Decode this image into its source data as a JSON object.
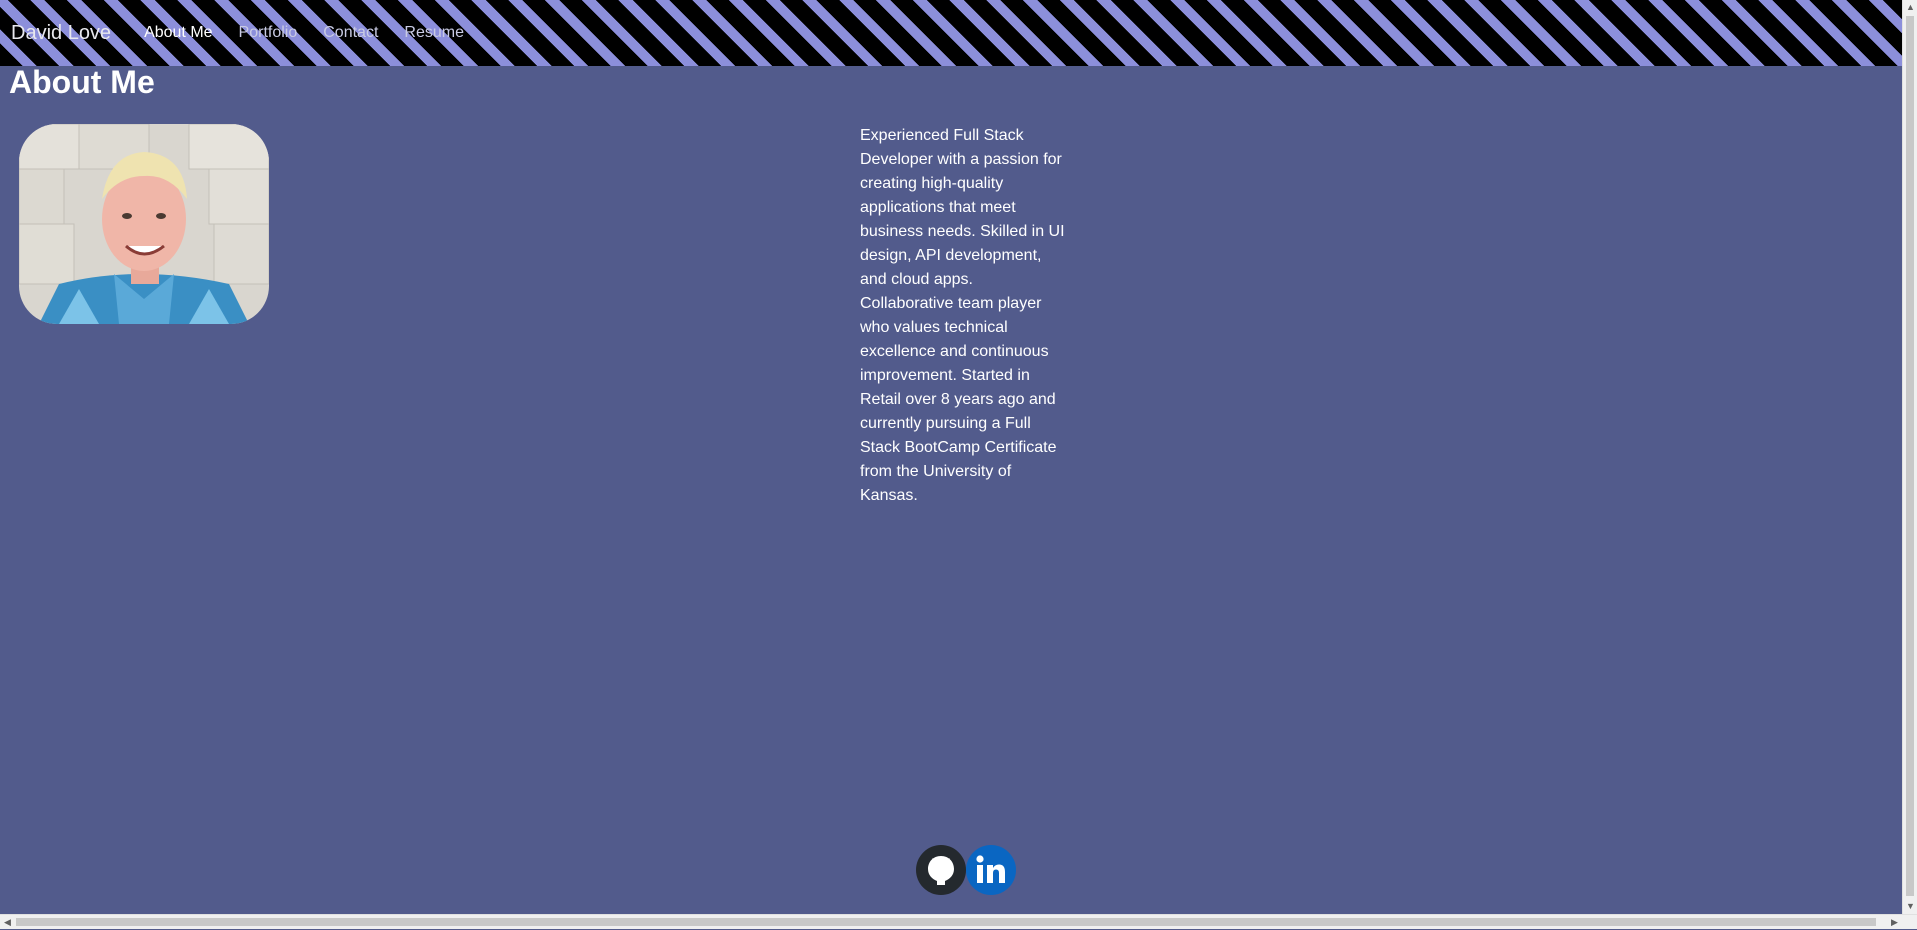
{
  "navbar": {
    "brand": "David Love",
    "links": [
      {
        "label": "About Me",
        "active": true
      },
      {
        "label": "Portfolio",
        "active": false
      },
      {
        "label": "Contact",
        "active": false
      },
      {
        "label": "Resume",
        "active": false
      }
    ],
    "stripe_colors": [
      "#000000",
      "#8c8fdb"
    ]
  },
  "main": {
    "title": "About Me",
    "bio": "Experienced Full Stack Developer with a passion for creating high-quality applications that meet business needs. Skilled in UI design, API development, and cloud apps. Collaborative team player who values technical excellence and continuous improvement. Started in Retail over 8 years ago and currently pursuing a Full Stack BootCamp Certificate from the University of Kansas."
  },
  "footer": {
    "icons": [
      "github-icon",
      "linkedin-icon"
    ]
  },
  "colors": {
    "background": "#525b8c",
    "text": "#ffffff",
    "github": "#24292e",
    "linkedin": "#0a66c2"
  }
}
